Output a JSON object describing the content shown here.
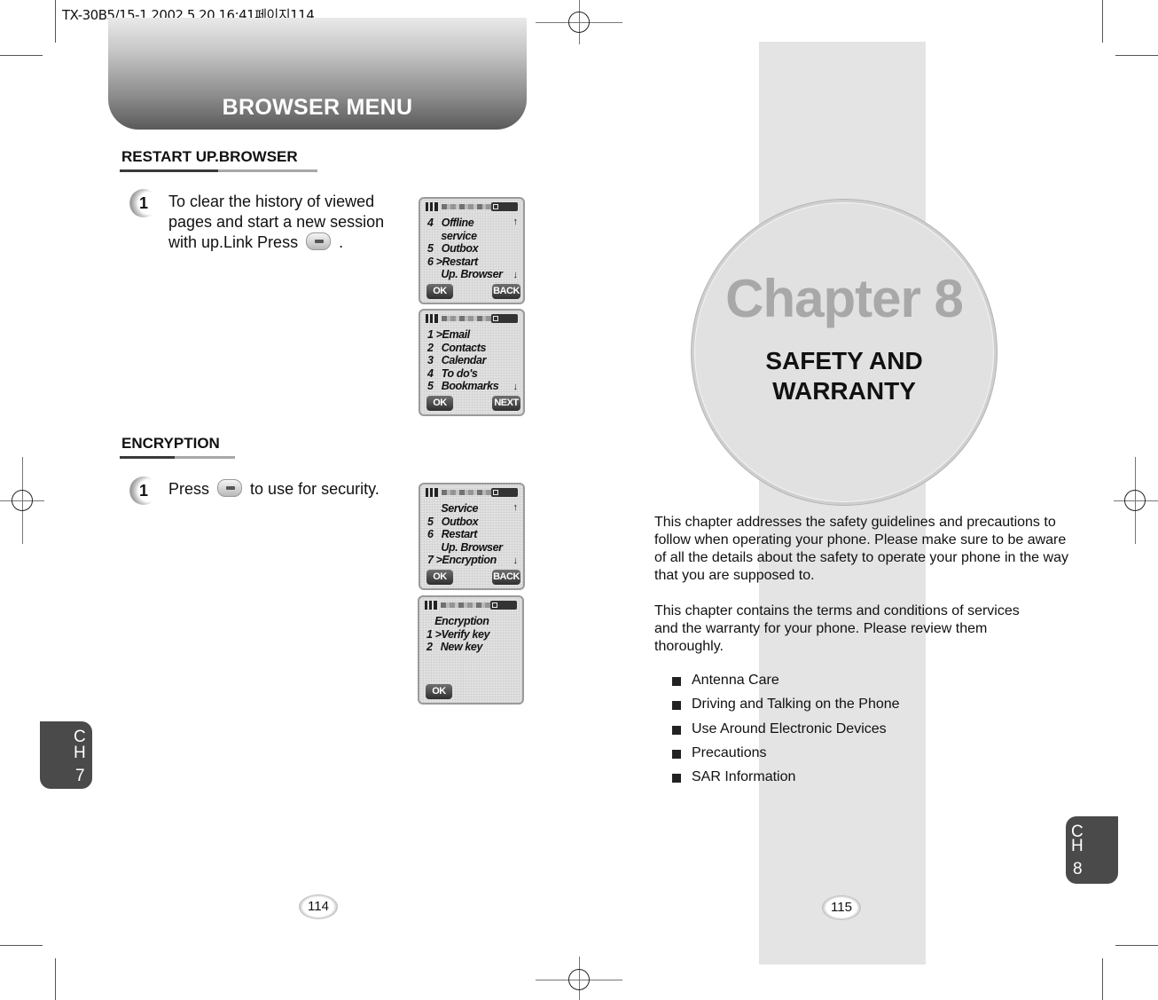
{
  "print_slug": "TX-30B5/15-1  2002.5.20 16:41페이지114",
  "left_page": {
    "banner_title": "BROWSER MENU",
    "sections": [
      {
        "title": "RESTART UP.BROWSER",
        "step_number": "1",
        "step_text_before_icon": "To clear the history of viewed pages and start a new session with up.Link Press",
        "step_icon": "end-key-icon",
        "step_text_after_icon": ".",
        "screens": [
          {
            "lines": [
              "4   Offline",
              "     service",
              "5   Outbox",
              "6 >Restart",
              "     Up. Browser"
            ],
            "up_arrow": "↑",
            "down_arrow": "↓",
            "left_softkey": "OK",
            "right_softkey": "BACK"
          },
          {
            "lines": [
              "1 >Email",
              "2   Contacts",
              "3   Calendar",
              "4   To do's",
              "5   Bookmarks"
            ],
            "up_arrow": "",
            "down_arrow": "↓",
            "left_softkey": "OK",
            "right_softkey": "NEXT"
          }
        ]
      },
      {
        "title": "ENCRYPTION",
        "step_number": "1",
        "step_text_before_icon": "Press",
        "step_icon": "key-7-icon",
        "step_text_after_icon": "to use for security.",
        "screens": [
          {
            "lines": [
              "     Service",
              "5   Outbox",
              "6   Restart",
              "     Up. Browser",
              "7 >Encryption"
            ],
            "up_arrow": "↑",
            "down_arrow": "↓",
            "left_softkey": "OK",
            "right_softkey": "BACK"
          },
          {
            "lines": [
              "   Encryption",
              "1 >Verify key",
              "2   New key"
            ],
            "up_arrow": "",
            "down_arrow": "",
            "left_softkey": "OK",
            "right_softkey": ""
          }
        ]
      }
    ],
    "chapter_tab": {
      "c": "C",
      "h": "H",
      "num": "7"
    },
    "page_number": "114"
  },
  "right_page": {
    "chapter_label": "Chapter 8",
    "chapter_title_line1": "SAFETY AND",
    "chapter_title_line2": "WARRANTY",
    "paragraphs": [
      "This chapter addresses the safety guidelines and precautions to follow when operating your phone. Please make sure to be aware of all the details about the safety to operate your phone in the way that you are supposed to.",
      "This chapter contains the terms and conditions of services and the warranty for your phone. Please review them thoroughly."
    ],
    "topics": [
      "Antenna Care",
      "Driving and Talking on the Phone",
      "Use Around Electronic Devices",
      "Precautions",
      "SAR Information"
    ],
    "chapter_tab": {
      "c": "C",
      "h": "H",
      "num": "8"
    },
    "page_number": "115"
  }
}
